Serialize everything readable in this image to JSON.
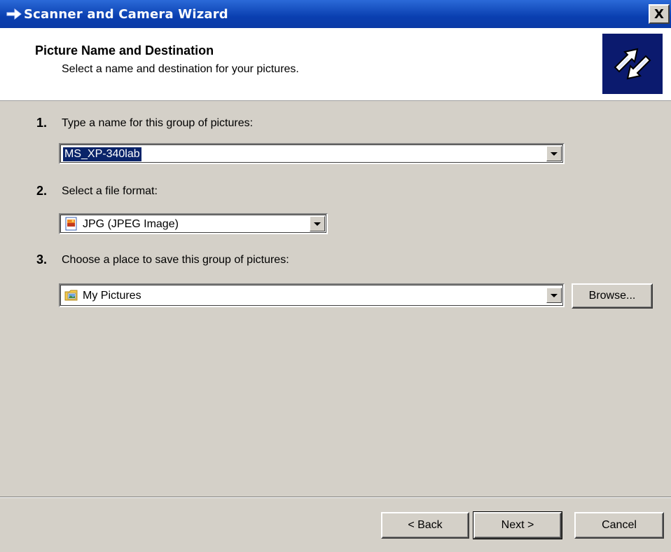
{
  "window": {
    "title": "Scanner and Camera Wizard",
    "close_label": "X",
    "colors": {
      "titlebar": "#0a3fb0",
      "face": "#d4d0c8",
      "selection": "#0a246a",
      "header_logo_bg": "#0b1a6e"
    }
  },
  "header": {
    "title": "Picture Name and Destination",
    "subtitle": "Select a name and destination for your pictures.",
    "logo_icon": "scanner-camera-arrows-icon"
  },
  "steps": [
    {
      "number": "1.",
      "label": "Type a name for this group of pictures:",
      "value": "MS_XP-340lab"
    },
    {
      "number": "2.",
      "label": "Select a file format:",
      "value": "JPG (JPEG Image)",
      "icon": "jpeg-file-icon"
    },
    {
      "number": "3.",
      "label": "Choose a place to save this group of pictures:",
      "value": "My Pictures",
      "icon": "my-pictures-folder-icon",
      "browse_label": "Browse..."
    }
  ],
  "footer": {
    "back_label": "< Back",
    "next_label": "Next >",
    "cancel_label": "Cancel"
  }
}
